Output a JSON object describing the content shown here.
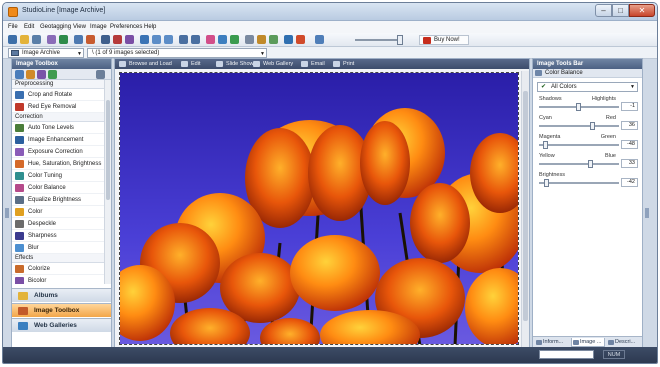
{
  "window": {
    "title": "StudioLine [Image Archive]"
  },
  "menu": [
    "File",
    "Edit",
    "Geotagging",
    "View",
    "Image",
    "Preferences",
    "Help"
  ],
  "toolbar": {
    "buy_label": "Buy Now!",
    "archive_select": "Image Archive",
    "selection_select": "\\ (1 of 9 images selected)"
  },
  "left_panel": {
    "title": "Image Toolbox",
    "sections": [
      {
        "label": "Preprocessing",
        "items": [
          {
            "label": "Crop and Rotate",
            "icon": "crop-icon",
            "color": "#3a6fb0"
          },
          {
            "label": "Red Eye Removal",
            "icon": "eye-icon",
            "color": "#c0392b"
          }
        ]
      },
      {
        "label": "Correction",
        "items": [
          {
            "label": "Auto Tone Levels",
            "icon": "levels-icon",
            "color": "#4a7d3a"
          },
          {
            "label": "Image Enhancement",
            "icon": "enhance-icon",
            "color": "#2b5f9e"
          },
          {
            "label": "Exposure Correction",
            "icon": "exposure-icon",
            "color": "#8a5cb8"
          },
          {
            "label": "Hue, Saturation, Brightness",
            "icon": "hue-icon",
            "color": "#d4692a"
          },
          {
            "label": "Color Tuning",
            "icon": "color-tuning-icon",
            "color": "#2f8f8f"
          },
          {
            "label": "Color Balance",
            "icon": "color-balance-icon",
            "color": "#b54a8a"
          },
          {
            "label": "Equalize Brightness",
            "icon": "equalize-icon",
            "color": "#5a6e86"
          },
          {
            "label": "Color",
            "icon": "palette-icon",
            "color": "#e0a020"
          },
          {
            "label": "Despeckle",
            "icon": "despeckle-icon",
            "color": "#6b6b6b"
          },
          {
            "label": "Sharpness",
            "icon": "sharpness-icon",
            "color": "#3b3b8f"
          },
          {
            "label": "Blur",
            "icon": "blur-icon",
            "color": "#4c8fd0"
          }
        ]
      },
      {
        "label": "Effects",
        "items": [
          {
            "label": "Colorize",
            "icon": "colorize-icon",
            "color": "#c86b2c"
          },
          {
            "label": "Bicolor",
            "icon": "bicolor-icon",
            "color": "#7a4fa5"
          }
        ]
      }
    ],
    "nav": [
      {
        "label": "Albums",
        "icon": "albums-icon",
        "active": false
      },
      {
        "label": "Image Toolbox",
        "icon": "toolbox-icon",
        "active": true
      },
      {
        "label": "Web Galleries",
        "icon": "globe-icon",
        "active": false
      }
    ]
  },
  "center_tabs": [
    {
      "label": "Browse and Load",
      "icon": "folder-icon"
    },
    {
      "label": "Edit",
      "icon": "edit-icon"
    },
    {
      "label": "Slide Show",
      "icon": "slideshow-icon"
    },
    {
      "label": "Web Gallery",
      "icon": "web-icon"
    },
    {
      "label": "Email",
      "icon": "email-icon"
    },
    {
      "label": "Print",
      "icon": "print-icon"
    }
  ],
  "right_panel": {
    "title": "Image Tools Bar",
    "subtitle": "Color Balance",
    "select_value": "All Colors",
    "sliders": [
      {
        "left": "Shadows",
        "right": "Highlights",
        "value": "-1",
        "level": 0.49
      },
      {
        "left": "Cyan",
        "right": "Red",
        "value": "36",
        "level": 0.68
      },
      {
        "left": "Magenta",
        "right": "Green",
        "value": "-48",
        "level": 0.05
      },
      {
        "left": "Yellow",
        "right": "Blue",
        "value": "33",
        "level": 0.65
      },
      {
        "left": "Brightness",
        "right": "",
        "value": "-42",
        "level": 0.07
      }
    ],
    "tabs": [
      {
        "label": "Inform...",
        "active": false
      },
      {
        "label": "Image ...",
        "active": true
      },
      {
        "label": "Descri...",
        "active": false
      }
    ]
  },
  "status": {
    "num": "NUM"
  },
  "colors": {
    "accent_active": "#f3a64a",
    "title_bar": "#b9cbe2",
    "panel_header": "#4c6183"
  }
}
